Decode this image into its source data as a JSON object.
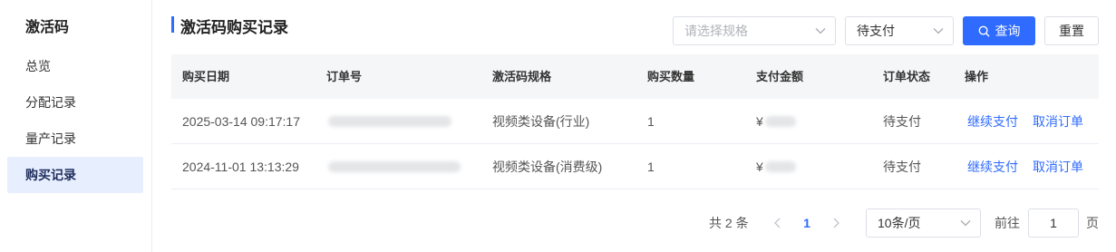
{
  "sidebar": {
    "title": "激活码",
    "items": [
      {
        "label": "总览"
      },
      {
        "label": "分配记录"
      },
      {
        "label": "量产记录"
      },
      {
        "label": "购买记录",
        "active": true
      }
    ]
  },
  "header": {
    "title": "激活码购买记录",
    "spec_placeholder": "请选择规格",
    "status_value": "待支付",
    "query_label": "查询",
    "reset_label": "重置"
  },
  "table": {
    "columns": [
      "购买日期",
      "订单号",
      "激活码规格",
      "购买数量",
      "支付金额",
      "订单状态",
      "操作"
    ],
    "rows": [
      {
        "date": "2025-03-14 09:17:17",
        "spec": "视频类设备(行业)",
        "quantity": "1",
        "currency": "¥",
        "status": "待支付",
        "action_pay": "继续支付",
        "action_cancel": "取消订单"
      },
      {
        "date": "2024-11-01 13:13:29",
        "spec": "视频类设备(消费级)",
        "quantity": "1",
        "currency": "¥",
        "status": "待支付",
        "action_pay": "继续支付",
        "action_cancel": "取消订单"
      }
    ]
  },
  "pagination": {
    "total_text": "共 2 条",
    "current_page": "1",
    "page_size": "10条/页",
    "goto_prefix": "前往",
    "goto_value": "1",
    "goto_suffix": "页"
  },
  "colors": {
    "accent": "#2f6bff",
    "active_bg": "#e7efff",
    "header_bg": "#f5f6f8"
  }
}
